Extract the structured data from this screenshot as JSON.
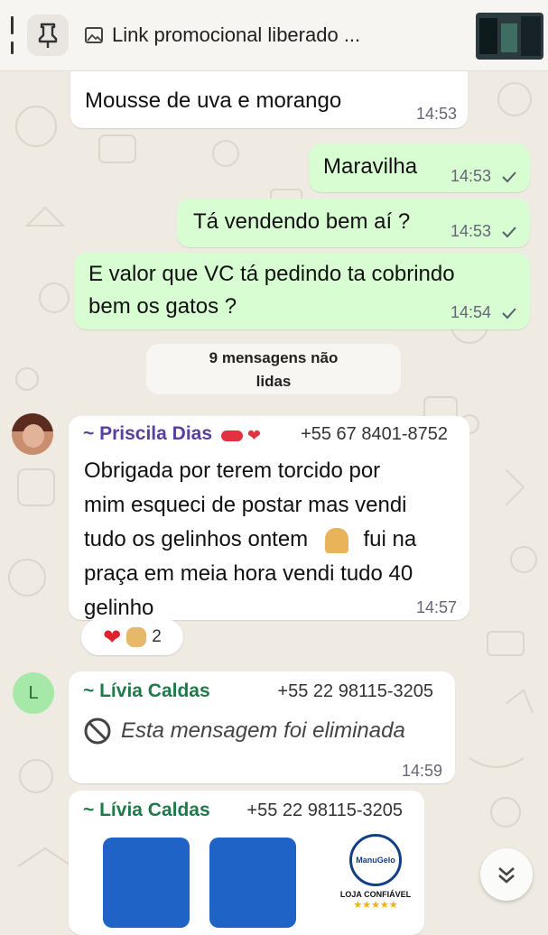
{
  "pinned": {
    "text": "Link promocional liberado ...",
    "icon": "pin-icon",
    "media_icon": "image-icon"
  },
  "messages": [
    {
      "text": "Mousse de uva e morango",
      "time": "14:53",
      "direction": "in"
    },
    {
      "text": "Maravilha",
      "time": "14:53",
      "direction": "out",
      "status": "sent-check"
    },
    {
      "text": "Tá vendendo bem aí ?",
      "time": "14:53",
      "direction": "out",
      "status": "sent-check"
    },
    {
      "text_line1": "E valor que VC tá pedindo ta cobrindo",
      "text_line2": "bem os gatos ?",
      "time": "14:54",
      "direction": "out",
      "status": "sent-check"
    }
  ],
  "unread": {
    "line1": "9 mensagens não",
    "line2": "lidas"
  },
  "priscila": {
    "name": "~ Priscila Dias",
    "phone": "+55 67 8401-8752",
    "lines": [
      "Obrigada por terem torcido por",
      "mim esqueci de postar mas vendi",
      "tudo os gelinhos ontem",
      "fui na",
      "praça em meia hora vendi tudo 40",
      "gelinho"
    ],
    "time": "14:57",
    "reaction_count": "2"
  },
  "livia1": {
    "avatar_letter": "L",
    "name": "~ Lívia Caldas",
    "phone": "+55 22 98115-3205",
    "deleted_text": "Esta mensagem foi eliminada",
    "time": "14:59"
  },
  "livia2": {
    "name": "~ Lívia Caldas",
    "phone": "+55 22 98115-3205",
    "logo_brand": "ManuGelo",
    "logo_tagline": "LOJA CONFIÁVEL",
    "logo_stars": "★★★★★"
  },
  "colors": {
    "incoming": "#ffffff",
    "outgoing": "#d9fdd3",
    "chat_bg": "#efeae2",
    "priscila_name": "#5b3fa0",
    "livia_name": "#1f7a4a",
    "tick": "#667781"
  }
}
